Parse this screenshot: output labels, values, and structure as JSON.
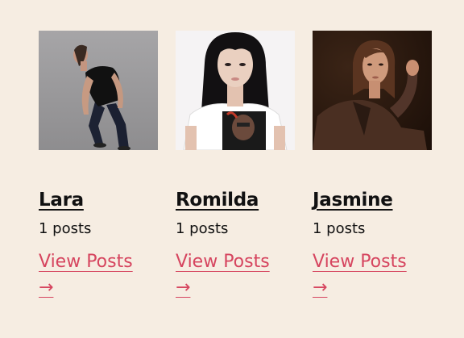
{
  "authors": [
    {
      "name": "Lara",
      "posts": "1 posts",
      "link_label": "View Posts",
      "arrow": "→",
      "photo_icon": "portrait-lara",
      "bg": "#9c9b9d"
    },
    {
      "name": "Romilda",
      "posts": "1 posts",
      "link_label": "View Posts",
      "arrow": "→",
      "photo_icon": "portrait-romilda",
      "bg": "#f4f2f3"
    },
    {
      "name": "Jasmine",
      "posts": "1 posts",
      "link_label": "View Posts",
      "arrow": "→",
      "photo_icon": "portrait-jasmine",
      "bg": "#2d1a10"
    }
  ],
  "colors": {
    "background": "#f6ede2",
    "link": "#d6455f",
    "text": "#111111"
  }
}
